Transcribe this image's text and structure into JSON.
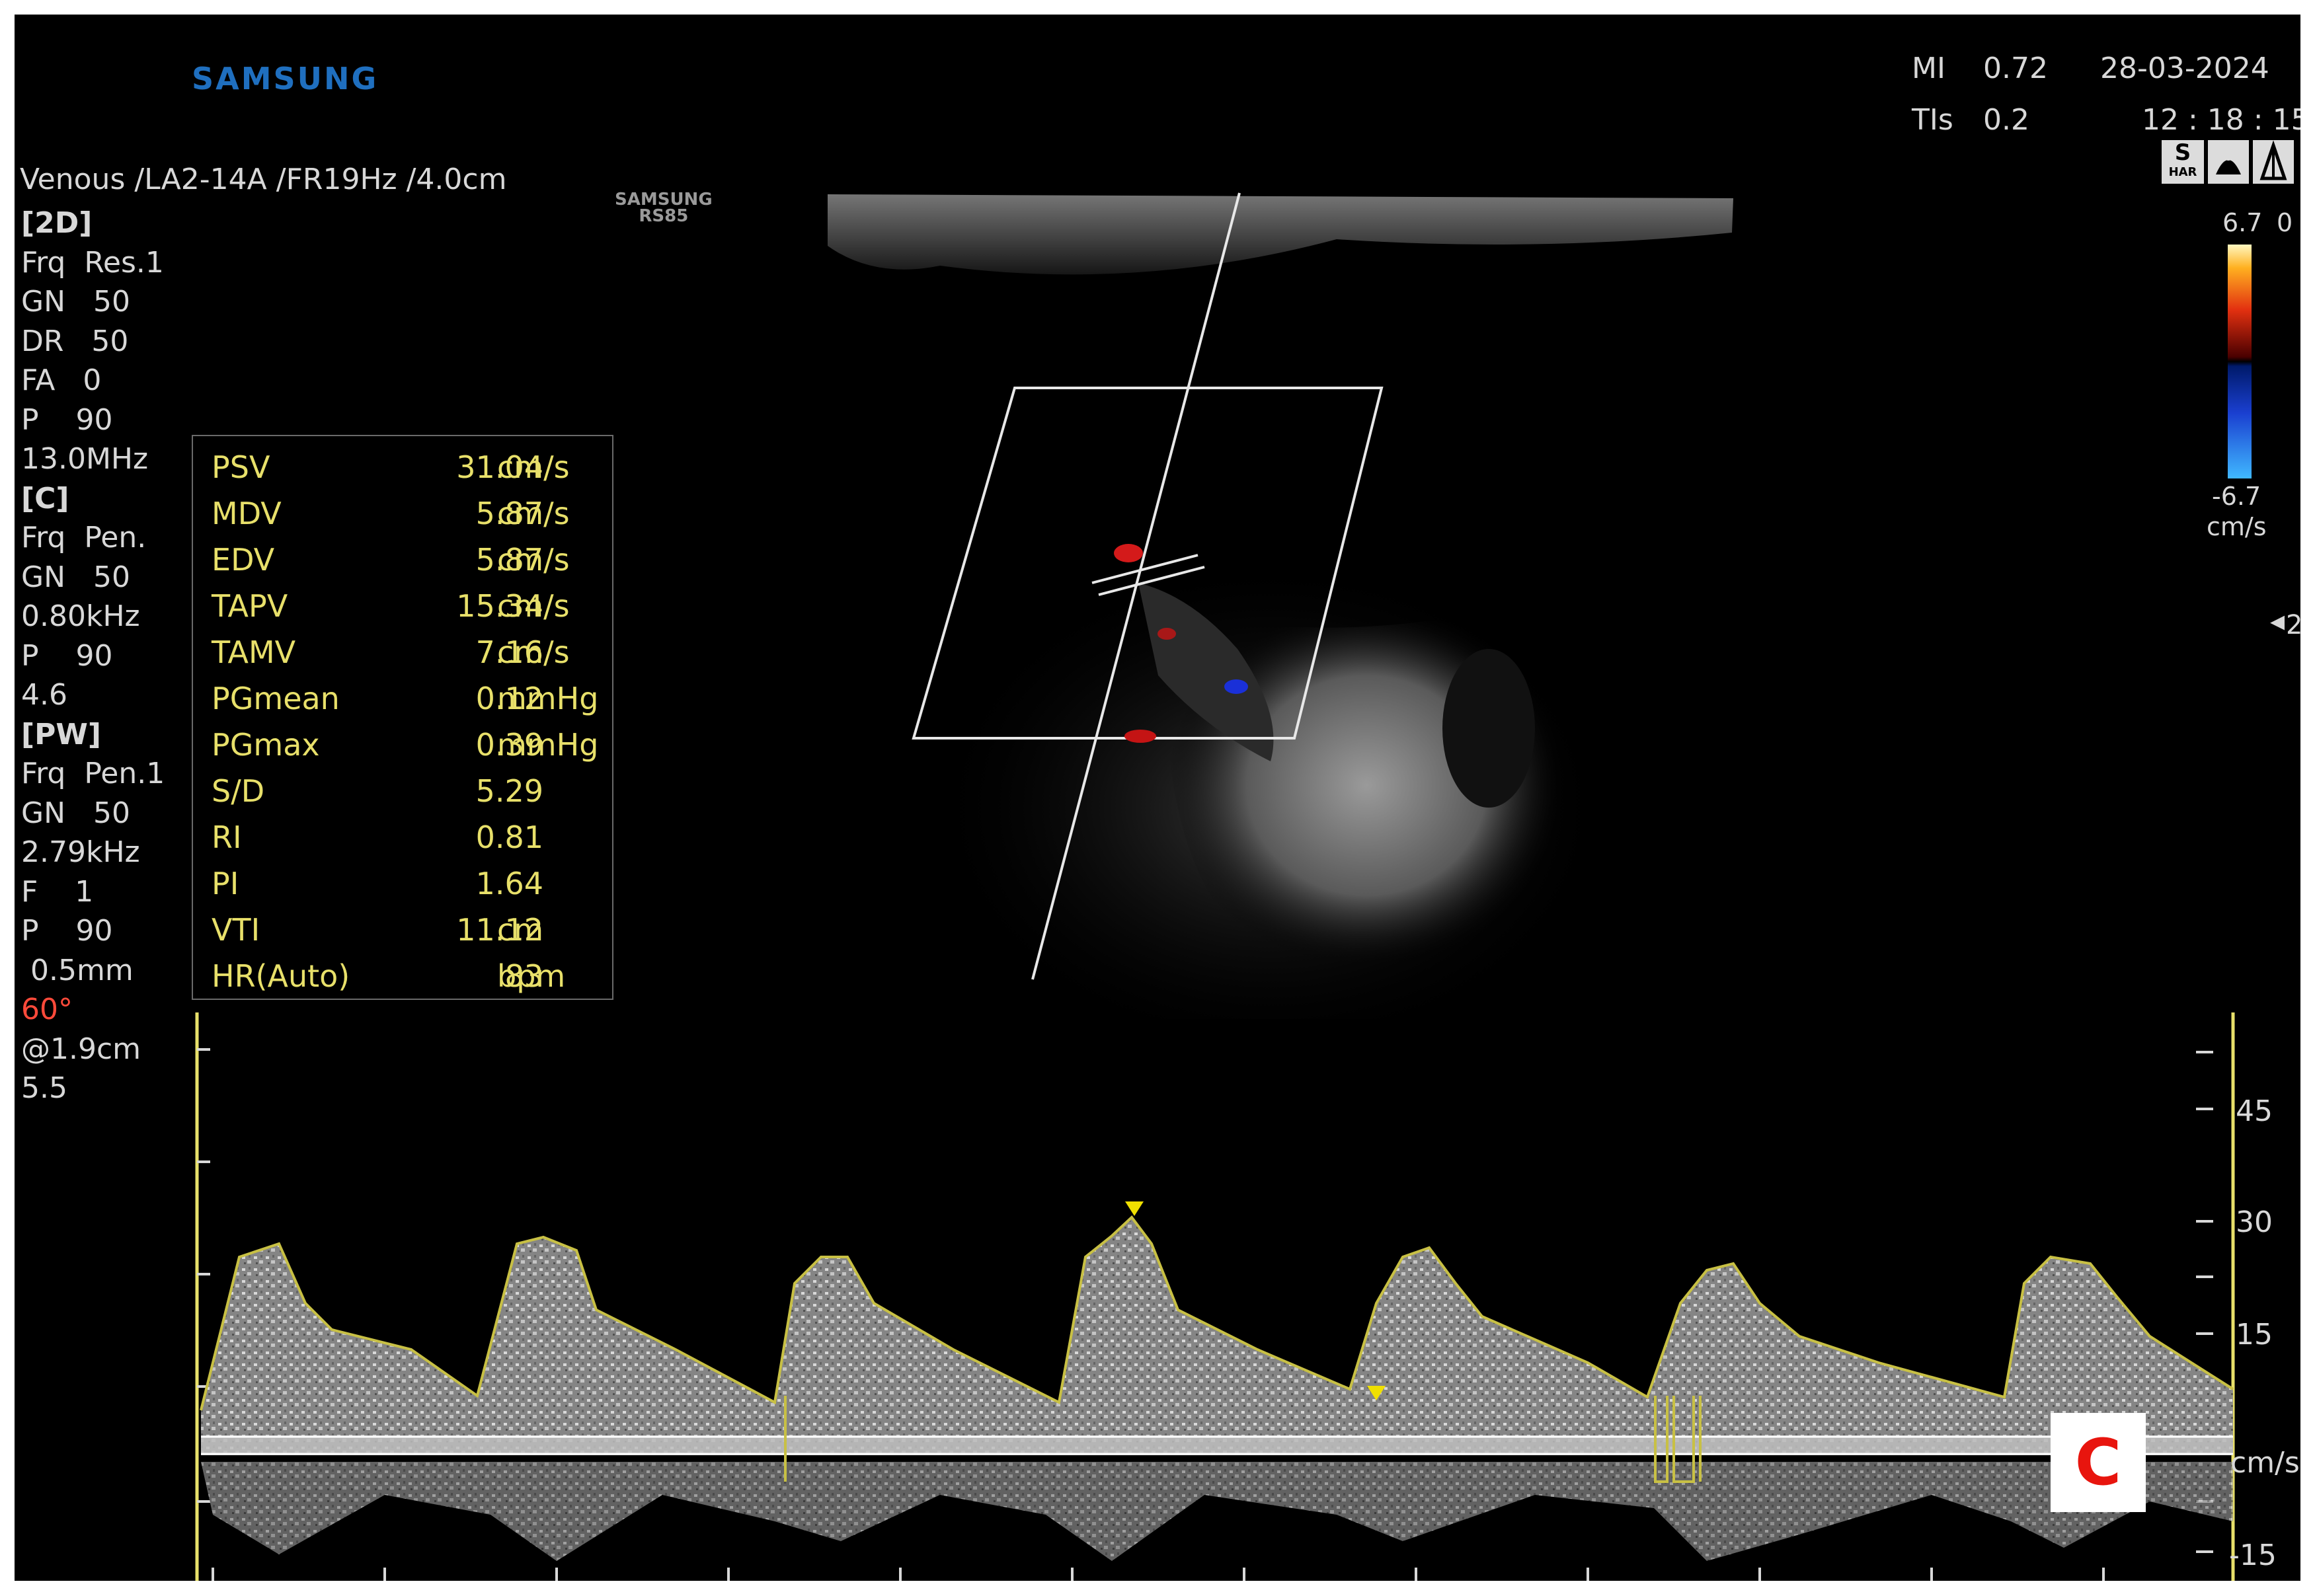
{
  "header": {
    "brand": "SAMSUNG",
    "probe_brand": "SAMSUNG",
    "probe_model": "RS85",
    "mi_label": "MI",
    "mi_value": "0.72",
    "tis_label": "TIs",
    "tis_value": "0.2",
    "date": "28-03-2024",
    "time": "12 : 18 : 15",
    "preset": "Venous /LA2-14A /FR19Hz /4.0cm"
  },
  "parameters": [
    {
      "text": "[2D]",
      "style": "hdr"
    },
    {
      "text": "Frq  Res.1",
      "style": ""
    },
    {
      "text": "GN   50",
      "style": ""
    },
    {
      "text": "DR   50",
      "style": ""
    },
    {
      "text": "FA   0",
      "style": ""
    },
    {
      "text": "P    90",
      "style": ""
    },
    {
      "text": "13.0MHz",
      "style": ""
    },
    {
      "text": "[C]",
      "style": "hdr"
    },
    {
      "text": "Frq  Pen.",
      "style": ""
    },
    {
      "text": "GN   50",
      "style": ""
    },
    {
      "text": "0.80kHz",
      "style": ""
    },
    {
      "text": "P    90",
      "style": ""
    },
    {
      "text": "4.6",
      "style": ""
    },
    {
      "text": "[PW]",
      "style": "hdr"
    },
    {
      "text": "Frq  Pen.1",
      "style": ""
    },
    {
      "text": "GN   50",
      "style": ""
    },
    {
      "text": "2.79kHz",
      "style": ""
    },
    {
      "text": "F    1",
      "style": ""
    },
    {
      "text": "P    90",
      "style": ""
    },
    {
      "text": " 0.5mm",
      "style": ""
    },
    {
      "text": "60°",
      "style": "red"
    },
    {
      "text": "@1.9cm",
      "style": ""
    },
    {
      "text": "5.5",
      "style": ""
    }
  ],
  "measurements": [
    {
      "name": "PSV",
      "value": "31.04",
      "unit": "cm/s"
    },
    {
      "name": "MDV",
      "value": "5.87",
      "unit": "cm/s"
    },
    {
      "name": "EDV",
      "value": "5.87",
      "unit": "cm/s"
    },
    {
      "name": "TAPV",
      "value": "15.34",
      "unit": "cm/s"
    },
    {
      "name": "TAMV",
      "value": "7.16",
      "unit": "cm/s"
    },
    {
      "name": "PGmean",
      "value": "0.12",
      "unit": "mmHg"
    },
    {
      "name": "PGmax",
      "value": "0.39",
      "unit": "mmHg"
    },
    {
      "name": "S/D",
      "value": "5.29",
      "unit": ""
    },
    {
      "name": "RI",
      "value": "0.81",
      "unit": ""
    },
    {
      "name": "PI",
      "value": "1.64",
      "unit": ""
    },
    {
      "name": "VTI",
      "value": "11.12",
      "unit": "cm"
    },
    {
      "name": "HR(Auto)",
      "value": "83",
      "unit": "bpm"
    }
  ],
  "color_scale": {
    "max_label": "6.7",
    "min_label": "-6.7",
    "unit": "cm/s",
    "top_glyph": "0",
    "side_glyph": "2"
  },
  "mode_icons": {
    "icon1": "S",
    "icon1_sub": "HAR"
  },
  "spectral_scale": {
    "ticks": [
      "45",
      "30",
      "15",
      "-15"
    ],
    "unit": "cm/s"
  },
  "panel_label": "C"
}
